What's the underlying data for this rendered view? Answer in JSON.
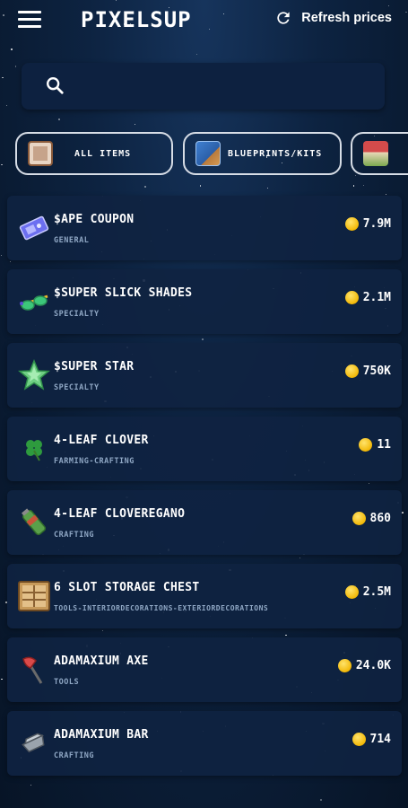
{
  "header": {
    "menu_icon": "hamburger-menu-icon",
    "logo": "PIXELSUP",
    "refresh_icon": "refresh-icon",
    "refresh_label": "Refresh prices"
  },
  "search": {
    "icon": "search-icon",
    "value": "",
    "placeholder": ""
  },
  "filters": [
    {
      "label": "ALL ITEMS",
      "icon": "all-items-icon"
    },
    {
      "label": "BLUEPRINTS/KITS",
      "icon": "blueprints-icon"
    },
    {
      "label": "",
      "icon": "decorations-icon"
    }
  ],
  "items": [
    {
      "name": "$APE COUPON",
      "category": "GENERAL",
      "price": "7.9M",
      "icon": "coupon-icon"
    },
    {
      "name": "$SUPER SLICK SHADES",
      "category": "SPECIALTY",
      "price": "2.1M",
      "icon": "shades-icon"
    },
    {
      "name": "$SUPER STAR",
      "category": "SPECIALTY",
      "price": "750K",
      "icon": "star-icon"
    },
    {
      "name": "4-LEAF CLOVER",
      "category": "FARMING-CRAFTING",
      "price": "11",
      "icon": "clover-icon"
    },
    {
      "name": "4-LEAF CLOVEREGANO",
      "category": "CRAFTING",
      "price": "860",
      "icon": "cloveregano-icon"
    },
    {
      "name": "6 SLOT STORAGE CHEST",
      "category": "TOOLS-INTERIORDECORATIONS-EXTERIORDECORATIONS",
      "price": "2.5M",
      "icon": "storage-chest-icon"
    },
    {
      "name": "ADAMAXIUM AXE",
      "category": "TOOLS",
      "price": "24.0K",
      "icon": "axe-icon"
    },
    {
      "name": "ADAMAXIUM BAR",
      "category": "CRAFTING",
      "price": "714",
      "icon": "metal-bar-icon"
    }
  ],
  "colors": {
    "background": "#0d2341",
    "card": "#0f2341",
    "coin": "#f2b807",
    "category_text": "#8fa7c4"
  }
}
